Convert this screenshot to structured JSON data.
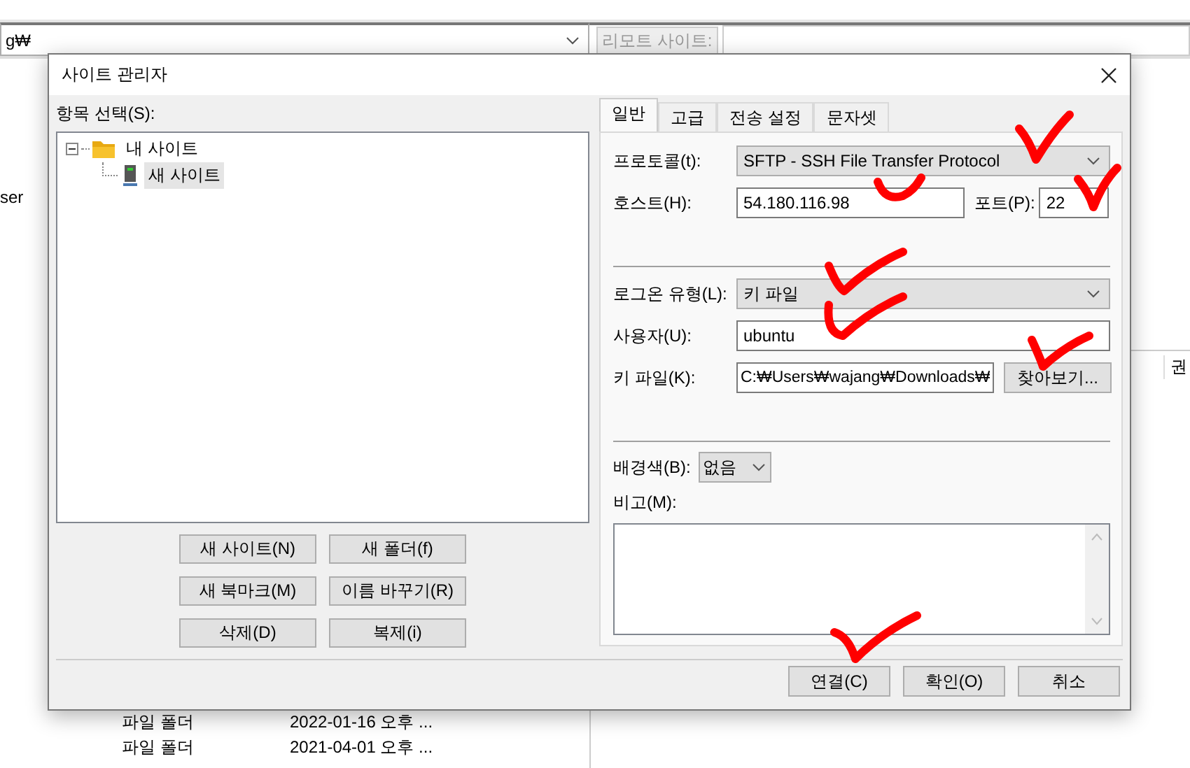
{
  "background": {
    "local_path": "g₩",
    "local_fragment": "ser",
    "remote_label": "리모트 사이트:",
    "remote_column_header": "권",
    "file_rows": [
      {
        "type": "파일 폴더",
        "modified": "2022-01-16 오후 ..."
      },
      {
        "type": "파일 폴더",
        "modified": "2021-04-01 오후 ..."
      }
    ]
  },
  "dialog": {
    "title": "사이트 관리자",
    "tree_label": "항목 선택(S):",
    "tree": [
      {
        "label": "내 사이트",
        "kind": "folder",
        "expanded": true,
        "selected": false,
        "children": [
          {
            "label": "새 사이트",
            "kind": "site",
            "selected": true
          }
        ]
      }
    ],
    "tree_buttons": [
      "새 사이트(N)",
      "새 폴더(f)",
      "새 북마크(M)",
      "이름 바꾸기(R)",
      "삭제(D)",
      "복제(i)"
    ],
    "tabs": [
      {
        "label": "일반",
        "selected": true
      },
      {
        "label": "고급",
        "selected": false
      },
      {
        "label": "전송 설정",
        "selected": false
      },
      {
        "label": "문자셋",
        "selected": false
      }
    ],
    "protocol": {
      "label": "프로토콜(t):",
      "value": "SFTP - SSH File Transfer Protocol"
    },
    "host": {
      "label": "호스트(H):",
      "value": "54.180.116.98"
    },
    "port": {
      "label": "포트(P):",
      "value": "22"
    },
    "logon_type": {
      "label": "로그온 유형(L):",
      "value": "키 파일"
    },
    "user": {
      "label": "사용자(U):",
      "value": "ubuntu"
    },
    "key_file": {
      "label": "키 파일(K):",
      "value": "C:₩Users₩wajang₩Downloads₩"
    },
    "browse_button": "찾아보기...",
    "background_color": {
      "label": "배경색(B):",
      "value": "없음"
    },
    "comments": {
      "label": "비고(M):"
    },
    "buttons": [
      "연결(C)",
      "확인(O)",
      "취소"
    ]
  }
}
